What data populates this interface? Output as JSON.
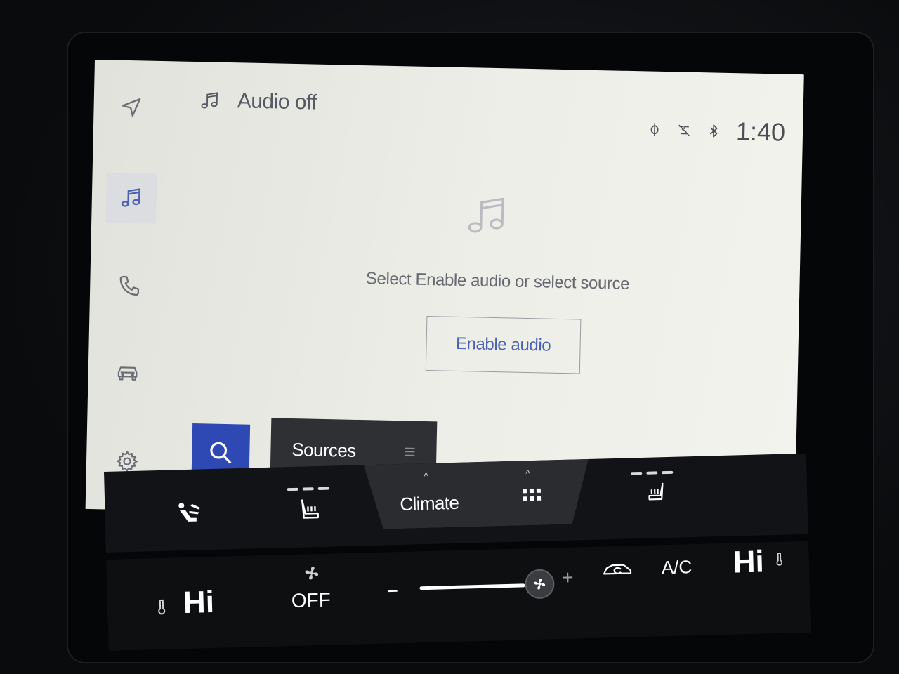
{
  "header": {
    "title": "Audio off",
    "clock": "1:40"
  },
  "main": {
    "hint": "Select Enable audio or select source",
    "enable_label": "Enable audio",
    "sources_label": "Sources"
  },
  "rail": {
    "items": [
      "navigation-icon",
      "music-icon",
      "phone-icon",
      "car-icon",
      "gear-icon"
    ],
    "active": "music-icon"
  },
  "climate": {
    "tab_label": "Climate",
    "driver_temp": "Hi",
    "fan_label": "OFF",
    "minus_label": "−",
    "plus_label": "+",
    "ac_label": "A/C",
    "passenger_temp": "Hi"
  },
  "colors": {
    "accent": "#4a61b4",
    "search_button": "#2e49b3",
    "sources_button": "#2f3033"
  }
}
